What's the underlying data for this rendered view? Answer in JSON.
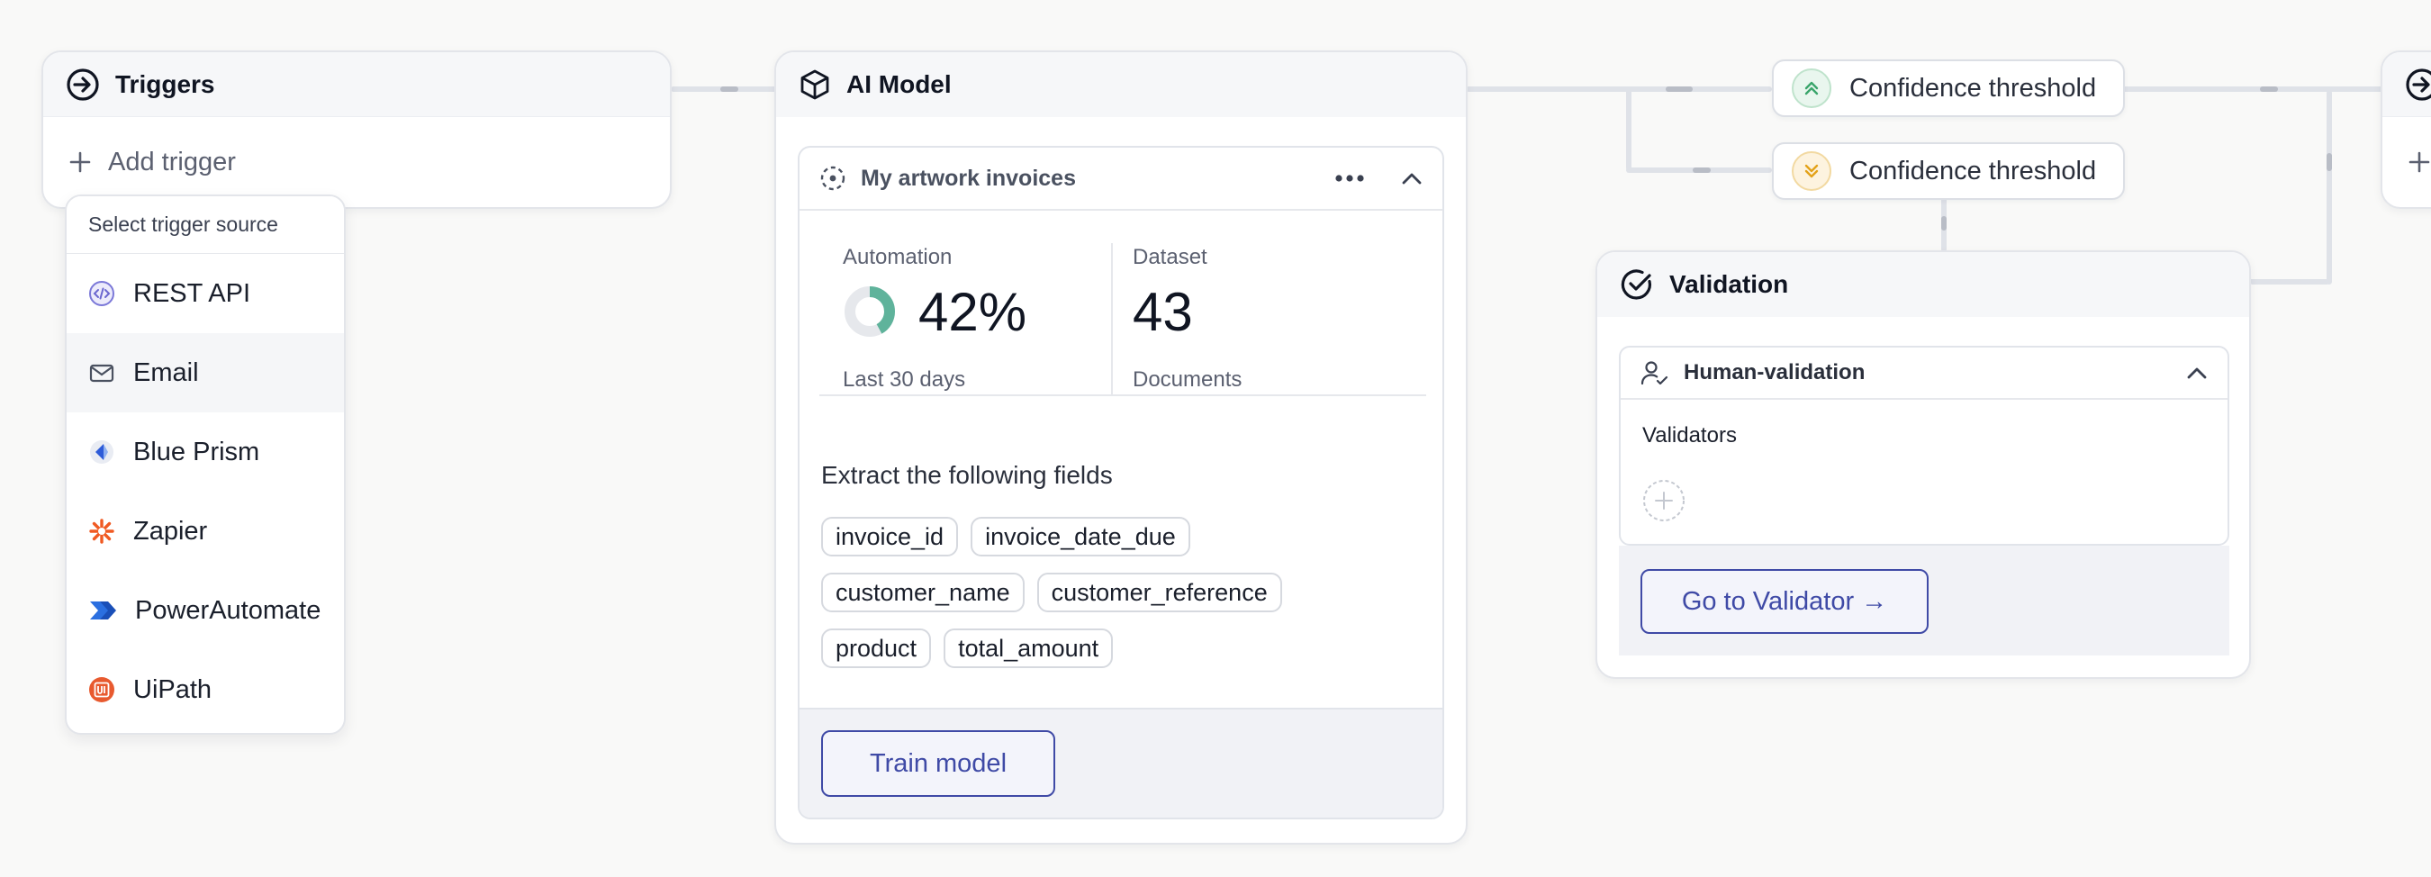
{
  "triggers": {
    "title": "Triggers",
    "add_label": "Add trigger",
    "menu": {
      "header": "Select trigger source",
      "items": [
        {
          "label": "REST API",
          "icon": "code-icon"
        },
        {
          "label": "Email",
          "icon": "mail-icon"
        },
        {
          "label": "Blue Prism",
          "icon": "blue-prism-icon"
        },
        {
          "label": "Zapier",
          "icon": "zapier-icon"
        },
        {
          "label": "PowerAutomate",
          "icon": "power-automate-icon"
        },
        {
          "label": "UiPath",
          "icon": "uipath-icon"
        }
      ]
    }
  },
  "ai_model": {
    "title": "AI Model",
    "model_name": "My artwork invoices",
    "automation": {
      "label": "Automation",
      "value": "42%",
      "fraction": 0.42,
      "period": "Last 30 days"
    },
    "dataset": {
      "label": "Dataset",
      "value": "43",
      "unit": "Documents"
    },
    "fields_title": "Extract the following fields",
    "fields": [
      "invoice_id",
      "invoice_date_due",
      "customer_name",
      "customer_reference",
      "product",
      "total_amount"
    ],
    "train_label": "Train model"
  },
  "thresholds": [
    {
      "label": "Confidence threshold",
      "kind": "high",
      "color": "#3aa56b"
    },
    {
      "label": "Confidence threshold",
      "kind": "low",
      "color": "#e3a21a"
    }
  ],
  "validation": {
    "title": "Validation",
    "section_title": "Human-validation",
    "validators_label": "Validators",
    "go_label": "Go to Validator →"
  },
  "colors": {
    "accent": "#3f4aa6",
    "automation_ring": "#5fb39b",
    "zapier": "#f05a22",
    "uipath": "#e85a2f"
  }
}
